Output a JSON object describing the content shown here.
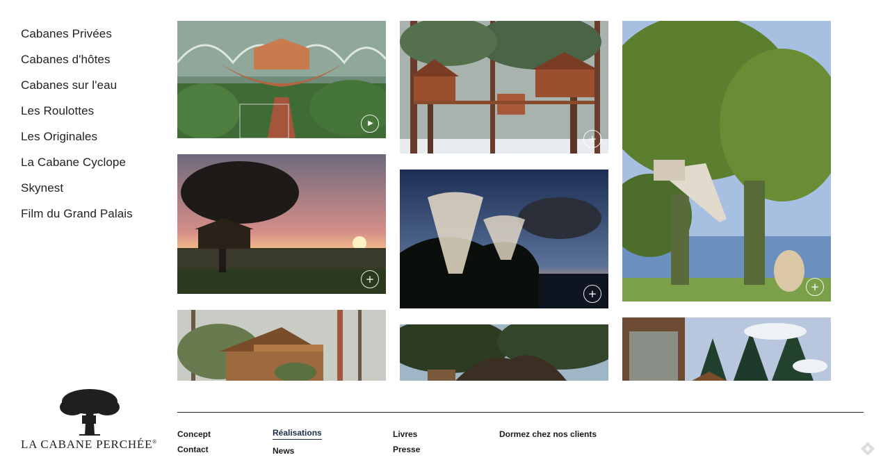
{
  "sidebar": {
    "items": [
      {
        "label": "Cabanes Privées"
      },
      {
        "label": "Cabanes d'hôtes"
      },
      {
        "label": "Cabanes sur l'eau"
      },
      {
        "label": "Les Roulottes"
      },
      {
        "label": "Les Originales"
      },
      {
        "label": "La Cabane Cyclope"
      },
      {
        "label": "Skynest"
      },
      {
        "label": "Film du Grand Palais"
      }
    ]
  },
  "gallery": {
    "tiles": [
      {
        "scene": "grand-palais-treehouse",
        "badge": "play-icon",
        "badge_glyph": "▶"
      },
      {
        "scene": "forest-treehouse-snow",
        "badge": "plus-icon",
        "badge_glyph": "+"
      },
      {
        "scene": "lakeside-tree-stairs",
        "badge": "plus-icon",
        "badge_glyph": "+"
      },
      {
        "scene": "sunset-treehouse",
        "badge": "plus-icon",
        "badge_glyph": "+"
      },
      {
        "scene": "tropical-tower-cabins",
        "badge": "plus-icon",
        "badge_glyph": "+"
      },
      {
        "scene": "wooden-cabin-trees",
        "badge": "",
        "badge_glyph": ""
      },
      {
        "scene": "oak-canopy",
        "badge": "",
        "badge_glyph": ""
      },
      {
        "scene": "snowy-chalet",
        "badge": "",
        "badge_glyph": ""
      }
    ]
  },
  "logo": {
    "wordmark": "LA CABANE PERCHÉE",
    "trademark": "®"
  },
  "footer": {
    "columns": [
      {
        "links": [
          {
            "label": "Concept"
          },
          {
            "label": "Contact"
          }
        ]
      },
      {
        "links": [
          {
            "label": "Réalisations",
            "active": true
          },
          {
            "label": "News"
          }
        ]
      },
      {
        "links": [
          {
            "label": "Livres"
          },
          {
            "label": "Presse"
          }
        ]
      },
      {
        "links": [
          {
            "label": "Dormez chez nos clients"
          }
        ]
      }
    ]
  },
  "colors": {
    "text": "#222222",
    "active_link": "#1d2b4a",
    "rule": "#1a1a1a"
  }
}
